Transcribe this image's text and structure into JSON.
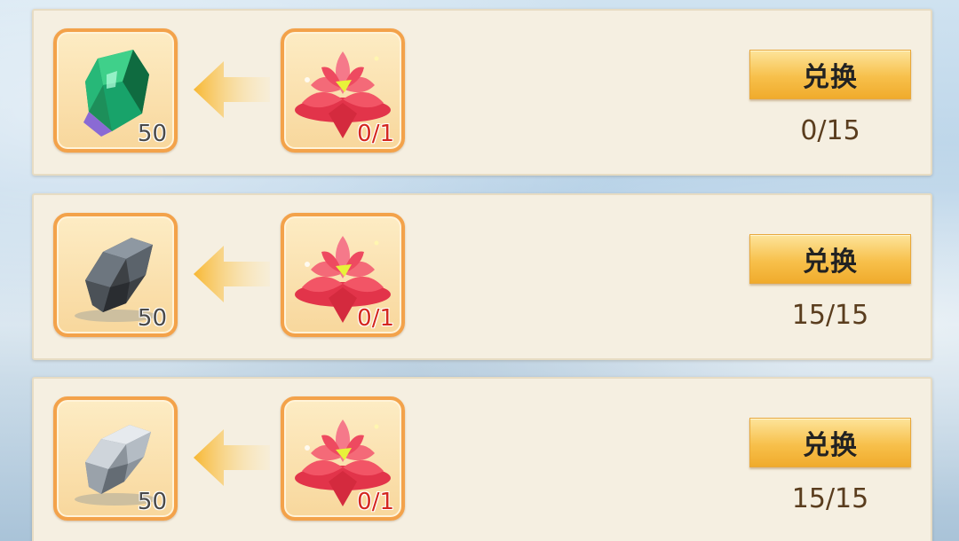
{
  "exchange_list": [
    {
      "reward": {
        "icon": "green-gem-icon",
        "count": "50"
      },
      "cost": {
        "icon": "red-lotus-icon",
        "count": "0/1"
      },
      "button_label": "兑换",
      "progress": "0/15"
    },
    {
      "reward": {
        "icon": "dark-ore-icon",
        "count": "50"
      },
      "cost": {
        "icon": "red-lotus-icon",
        "count": "0/1"
      },
      "button_label": "兑换",
      "progress": "15/15"
    },
    {
      "reward": {
        "icon": "silver-ore-icon",
        "count": "50"
      },
      "cost": {
        "icon": "red-lotus-icon",
        "count": "0/1"
      },
      "button_label": "兑换",
      "progress": "15/15"
    }
  ],
  "colors": {
    "slot_border": "#f3a24a",
    "button": "#f7c04b",
    "cost_count": "#d4281f"
  }
}
